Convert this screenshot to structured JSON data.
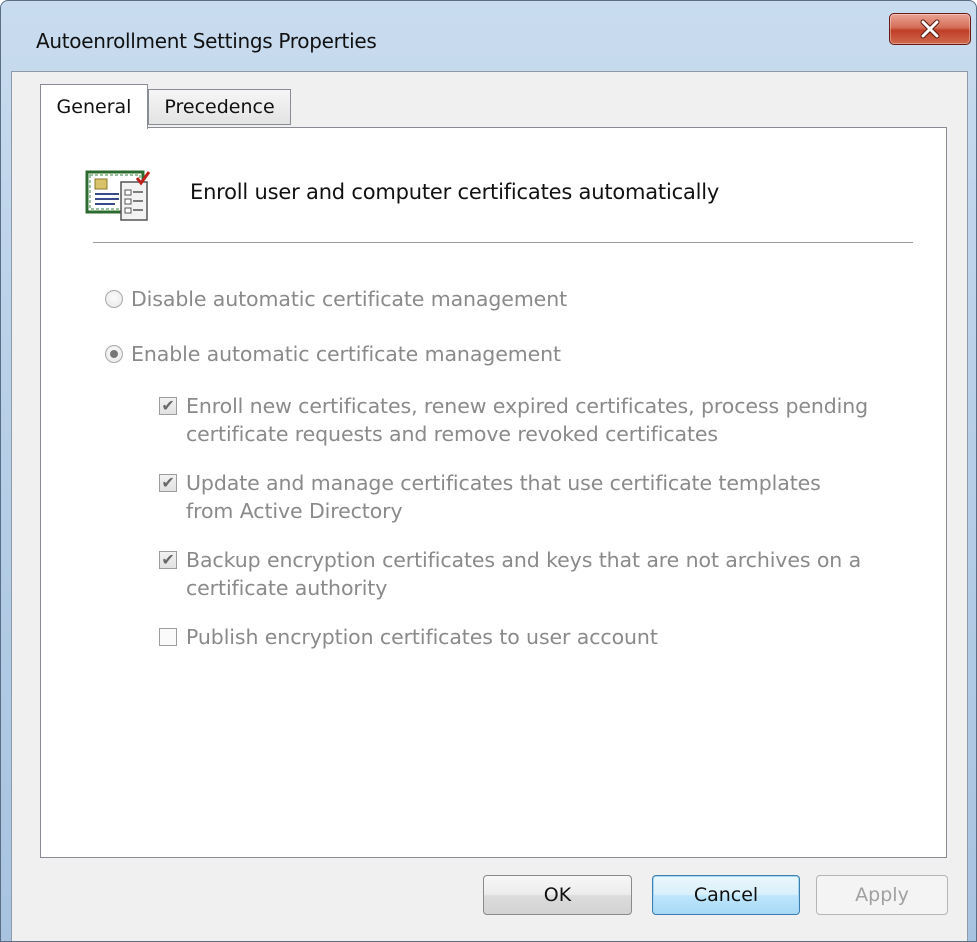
{
  "window": {
    "title": "Autoenrollment Settings Properties"
  },
  "tabs": [
    {
      "label": "General",
      "selected": true
    },
    {
      "label": "Precedence",
      "selected": false
    }
  ],
  "header": {
    "icon": "certificate-icon",
    "text": "Enroll user and computer certificates automatically"
  },
  "options": {
    "disable": {
      "label": "Disable automatic certificate management",
      "selected": false
    },
    "enable": {
      "label": "Enable automatic certificate management",
      "selected": true
    }
  },
  "checkboxes": [
    {
      "line1": "Enroll new certificates, renew expired certificates, process pending",
      "line2": "certificate requests and remove revoked certificates",
      "checked": true
    },
    {
      "line1": "Update and manage certificates that use certificate templates",
      "line2": "from Active Directory",
      "checked": true
    },
    {
      "line1": "Backup encryption certificates and keys that are not archives on a",
      "line2": "certificate authority",
      "checked": true
    },
    {
      "line1": "Publish encryption certificates to user account",
      "line2": "",
      "checked": false
    }
  ],
  "buttons": {
    "ok": "OK",
    "cancel": "Cancel",
    "apply": "Apply"
  },
  "colors": {
    "disabled_text": "#8a8a8a",
    "close_button": "#c4452e",
    "default_button_border": "#3c7fb1"
  }
}
